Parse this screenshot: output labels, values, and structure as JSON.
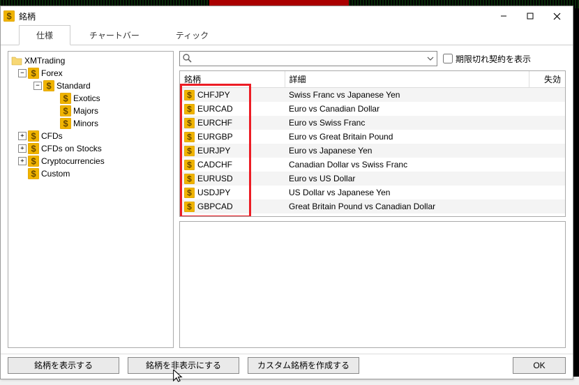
{
  "window": {
    "title": "銘柄"
  },
  "tabs": [
    {
      "id": "spec",
      "label": "仕様",
      "active": true
    },
    {
      "id": "chartbar",
      "label": "チャートバー",
      "active": false
    },
    {
      "id": "tick",
      "label": "ティック",
      "active": false
    }
  ],
  "tree": {
    "root": {
      "label": "XMTrading"
    },
    "forex": {
      "label": "Forex"
    },
    "standard": {
      "label": "Standard"
    },
    "standard_children": [
      {
        "label": "Exotics"
      },
      {
        "label": "Majors"
      },
      {
        "label": "Minors"
      }
    ],
    "siblings": [
      {
        "label": "CFDs"
      },
      {
        "label": "CFDs on Stocks"
      },
      {
        "label": "Cryptocurrencies"
      },
      {
        "label": "Custom"
      }
    ]
  },
  "search": {
    "placeholder": ""
  },
  "expired_checkbox": {
    "label": "期限切れ契約を表示",
    "checked": false
  },
  "table": {
    "headers": {
      "symbol": "銘柄",
      "detail": "詳細",
      "invalid": "失効"
    },
    "rows": [
      {
        "symbol": "CHFJPY",
        "detail": "Swiss Franc vs Japanese Yen"
      },
      {
        "symbol": "EURCAD",
        "detail": "Euro vs Canadian Dollar"
      },
      {
        "symbol": "EURCHF",
        "detail": "Euro vs Swiss Franc"
      },
      {
        "symbol": "EURGBP",
        "detail": "Euro vs Great Britain Pound"
      },
      {
        "symbol": "EURJPY",
        "detail": "Euro vs Japanese Yen"
      },
      {
        "symbol": "CADCHF",
        "detail": "Canadian Dollar vs Swiss Franc"
      },
      {
        "symbol": "EURUSD",
        "detail": "Euro vs US Dollar"
      },
      {
        "symbol": "USDJPY",
        "detail": "US Dollar vs Japanese Yen"
      },
      {
        "symbol": "GBPCAD",
        "detail": "Great Britain Pound vs Canadian Dollar"
      }
    ]
  },
  "footer": {
    "show": "銘柄を表示する",
    "hide": "銘柄を非表示にする",
    "custom": "カスタム銘柄を作成する",
    "ok": "OK"
  }
}
